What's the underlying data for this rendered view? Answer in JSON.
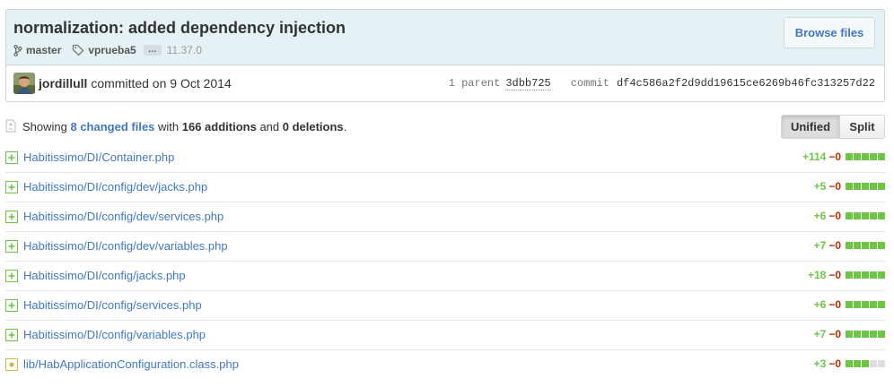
{
  "commit": {
    "title": "normalization: added dependency injection",
    "browse_label": "Browse files",
    "branch": "master",
    "tag": "vprueba5",
    "ellipsis": "…",
    "version": "11.37.0",
    "author": "jordillull",
    "committed_text": "committed on 9 Oct 2014",
    "parent_label": "1 parent",
    "parent_sha": "3dbb725",
    "commit_label": "commit",
    "commit_sha": "df4c586a2f2d9dd19615ce6269b46fc313257d22"
  },
  "toc": {
    "showing": "Showing ",
    "changed_files": "8 changed files",
    "with": " with ",
    "additions": "166 additions",
    "and": " and ",
    "deletions": "0 deletions",
    "period": ".",
    "unified_label": "Unified",
    "split_label": "Split"
  },
  "files": [
    {
      "name": "Habitissimo/DI/Container.php",
      "type": "added",
      "additions": "+114",
      "deletions": "−0",
      "added_blocks": 5
    },
    {
      "name": "Habitissimo/DI/config/dev/jacks.php",
      "type": "added",
      "additions": "+5",
      "deletions": "−0",
      "added_blocks": 5
    },
    {
      "name": "Habitissimo/DI/config/dev/services.php",
      "type": "added",
      "additions": "+6",
      "deletions": "−0",
      "added_blocks": 5
    },
    {
      "name": "Habitissimo/DI/config/dev/variables.php",
      "type": "added",
      "additions": "+7",
      "deletions": "−0",
      "added_blocks": 5
    },
    {
      "name": "Habitissimo/DI/config/jacks.php",
      "type": "added",
      "additions": "+18",
      "deletions": "−0",
      "added_blocks": 5
    },
    {
      "name": "Habitissimo/DI/config/services.php",
      "type": "added",
      "additions": "+6",
      "deletions": "−0",
      "added_blocks": 5
    },
    {
      "name": "Habitissimo/DI/config/variables.php",
      "type": "added",
      "additions": "+7",
      "deletions": "−0",
      "added_blocks": 5
    },
    {
      "name": "lib/HabApplicationConfiguration.class.php",
      "type": "modified",
      "additions": "+3",
      "deletions": "−0",
      "added_blocks": 3
    }
  ],
  "colors": {
    "addition": "#6cc644",
    "deletion": "#bd2c00",
    "modified": "#d0b44c",
    "link": "#4078c0"
  }
}
